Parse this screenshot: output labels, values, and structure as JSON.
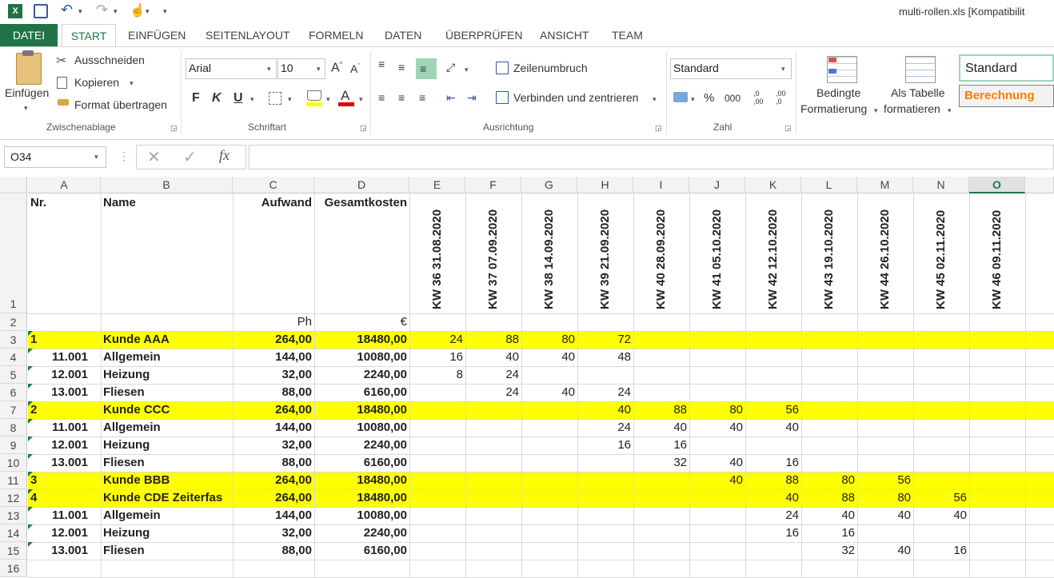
{
  "window": {
    "title": "multi-rollen.xls  [Kompatibilit"
  },
  "tabs": [
    "DATEI",
    "START",
    "EINFÜGEN",
    "SEITENLAYOUT",
    "FORMELN",
    "DATEN",
    "ÜBERPRÜFEN",
    "ANSICHT",
    "TEAM"
  ],
  "ribbon": {
    "clipboard": {
      "paste": "Einfügen",
      "cut": "Ausschneiden",
      "copy": "Kopieren",
      "format_painter": "Format übertragen",
      "label": "Zwischenablage"
    },
    "font": {
      "name": "Arial",
      "size": "10",
      "bold": "F",
      "italic": "K",
      "underline": "U",
      "label": "Schriftart"
    },
    "alignment": {
      "wrap": "Zeilenumbruch",
      "merge": "Verbinden und zentrieren",
      "label": "Ausrichtung"
    },
    "number": {
      "format": "Standard",
      "percent": "%",
      "thousands": "000",
      "label": "Zahl"
    },
    "styles": {
      "conditional1": "Bedingte",
      "conditional2": "Formatierung",
      "table1": "Als Tabelle",
      "table2": "formatieren",
      "style_standard": "Standard",
      "style_calc": "Berechnung"
    }
  },
  "formula_bar": {
    "name_box": "O34",
    "fx": "fx"
  },
  "colors": {
    "accent": "#217346",
    "highlight": "#ffff00",
    "calc": "#fa7d00"
  },
  "columns": [
    "A",
    "B",
    "C",
    "D",
    "E",
    "F",
    "G",
    "H",
    "I",
    "J",
    "K",
    "L",
    "M",
    "N",
    "O"
  ],
  "rows": [
    "1",
    "2",
    "3",
    "4",
    "5",
    "6",
    "7",
    "8",
    "9",
    "10",
    "11",
    "12",
    "13",
    "14",
    "15",
    "16"
  ],
  "header_row": {
    "nr": "Nr.",
    "name": "Name",
    "aufwand": "Aufwand",
    "gesamt": "Gesamtkosten"
  },
  "units": {
    "c": "Ph",
    "d": "€"
  },
  "weeks": [
    "KW 36 31.08.2020",
    "KW 37 07.09.2020",
    "KW 38 14.09.2020",
    "KW 39 21.09.2020",
    "KW 40 28.09.2020",
    "KW 41 05.10.2020",
    "KW 42 12.10.2020",
    "KW 43 19.10.2020",
    "KW 44 26.10.2020",
    "KW 45 02.11.2020",
    "KW 46 09.11.2020"
  ],
  "data_rows": [
    {
      "a": "1",
      "b": "Kunde AAA",
      "c": "264,00",
      "d": "18480,00",
      "w": [
        "24",
        "88",
        "80",
        "72",
        "",
        "",
        "",
        "",
        "",
        "",
        ""
      ],
      "yellow": true
    },
    {
      "a": "11.001",
      "b": "Allgemein",
      "c": "144,00",
      "d": "10080,00",
      "w": [
        "16",
        "40",
        "40",
        "48",
        "",
        "",
        "",
        "",
        "",
        "",
        ""
      ],
      "yellow": false
    },
    {
      "a": "12.001",
      "b": "Heizung",
      "c": "32,00",
      "d": "2240,00",
      "w": [
        "8",
        "24",
        "",
        "",
        "",
        "",
        "",
        "",
        "",
        "",
        ""
      ],
      "yellow": false
    },
    {
      "a": "13.001",
      "b": "Fliesen",
      "c": "88,00",
      "d": "6160,00",
      "w": [
        "",
        "24",
        "40",
        "24",
        "",
        "",
        "",
        "",
        "",
        "",
        ""
      ],
      "yellow": false
    },
    {
      "a": "2",
      "b": "Kunde CCC",
      "c": "264,00",
      "d": "18480,00",
      "w": [
        "",
        "",
        "",
        "40",
        "88",
        "80",
        "56",
        "",
        "",
        "",
        ""
      ],
      "yellow": true
    },
    {
      "a": "11.001",
      "b": "Allgemein",
      "c": "144,00",
      "d": "10080,00",
      "w": [
        "",
        "",
        "",
        "24",
        "40",
        "40",
        "40",
        "",
        "",
        "",
        ""
      ],
      "yellow": false
    },
    {
      "a": "12.001",
      "b": "Heizung",
      "c": "32,00",
      "d": "2240,00",
      "w": [
        "",
        "",
        "",
        "16",
        "16",
        "",
        "",
        "",
        "",
        "",
        ""
      ],
      "yellow": false
    },
    {
      "a": "13.001",
      "b": "Fliesen",
      "c": "88,00",
      "d": "6160,00",
      "w": [
        "",
        "",
        "",
        "",
        "32",
        "40",
        "16",
        "",
        "",
        "",
        ""
      ],
      "yellow": false
    },
    {
      "a": "3",
      "b": "Kunde BBB",
      "c": "264,00",
      "d": "18480,00",
      "w": [
        "",
        "",
        "",
        "",
        "",
        "40",
        "88",
        "80",
        "56",
        "",
        ""
      ],
      "yellow": true
    },
    {
      "a": "4",
      "b": "Kunde CDE Zeiterfas",
      "c": "264,00",
      "d": "18480,00",
      "w": [
        "",
        "",
        "",
        "",
        "",
        "",
        "40",
        "88",
        "80",
        "56",
        ""
      ],
      "yellow": true
    },
    {
      "a": "11.001",
      "b": "Allgemein",
      "c": "144,00",
      "d": "10080,00",
      "w": [
        "",
        "",
        "",
        "",
        "",
        "",
        "24",
        "40",
        "40",
        "40",
        ""
      ],
      "yellow": false
    },
    {
      "a": "12.001",
      "b": "Heizung",
      "c": "32,00",
      "d": "2240,00",
      "w": [
        "",
        "",
        "",
        "",
        "",
        "",
        "16",
        "16",
        "",
        "",
        ""
      ],
      "yellow": false
    },
    {
      "a": "13.001",
      "b": "Fliesen",
      "c": "88,00",
      "d": "6160,00",
      "w": [
        "",
        "",
        "",
        "",
        "",
        "",
        "",
        "32",
        "40",
        "16",
        ""
      ],
      "yellow": false
    }
  ]
}
